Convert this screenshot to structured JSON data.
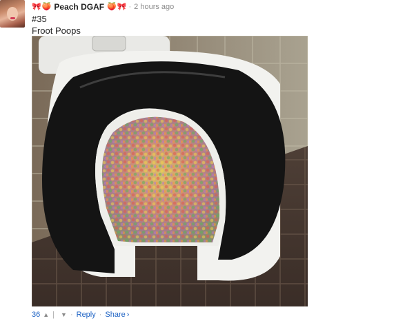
{
  "post": {
    "author": "Peach DGAF",
    "timestamp": "2 hours ago",
    "line1": "#35",
    "line2": "Froot Poops",
    "emoji_left": [
      "bow",
      "peach"
    ],
    "emoji_right": [
      "peach",
      "bow"
    ]
  },
  "actions": {
    "vote_count": "36",
    "upvote_icon": "chevron-up",
    "downvote_icon": "chevron-down",
    "reply_label": "Reply",
    "share_label": "Share",
    "share_arrow": "›"
  },
  "colors": {
    "link": "#1e63c4",
    "muted": "#8a8a8a"
  }
}
